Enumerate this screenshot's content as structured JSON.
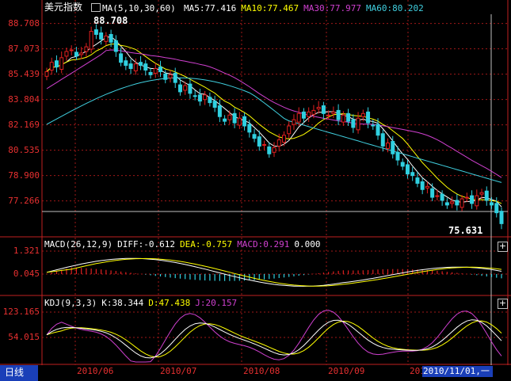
{
  "title": "美元指数",
  "ma_label": "MA(5,10,30,60)",
  "ma_values": [
    {
      "text": "MA5:77.416",
      "color": "#ffffff"
    },
    {
      "text": "MA10:77.467",
      "color": "#ffff00"
    },
    {
      "text": "MA30:77.977",
      "color": "#d040d0"
    },
    {
      "text": "MA60:80.202",
      "color": "#40d0e0"
    }
  ],
  "macd_label": "MACD(26,12,9)",
  "macd_values": [
    {
      "text": "DIFF:-0.612",
      "color": "#ffffff"
    },
    {
      "text": "DEA:-0.757",
      "color": "#ffff00"
    },
    {
      "text": "MACD:0.291",
      "color": "#d040d0"
    },
    {
      "text": "0.000",
      "color": "#ffffff"
    }
  ],
  "kdj_label": "KDJ(9,3,3)",
  "kdj_values": [
    {
      "text": "K:38.344",
      "color": "#ffffff"
    },
    {
      "text": "D:47.438",
      "color": "#ffff00"
    },
    {
      "text": "J:20.157",
      "color": "#d040d0"
    }
  ],
  "price_ticks": [
    "88.708",
    "87.073",
    "85.439",
    "83.804",
    "82.169",
    "80.535",
    "78.900",
    "77.266"
  ],
  "macd_ticks": [
    "1.321",
    "0.045"
  ],
  "kdj_ticks": [
    "123.165",
    "54.015"
  ],
  "max_label": "88.708",
  "min_label": "75.631",
  "period_label": "日线",
  "date_ticks": [
    "2010/06",
    "2010/07",
    "2010/08",
    "2010/09",
    "2010/"
  ],
  "cursor_date": "2010/11/01,一",
  "colors": {
    "up": "#e02020",
    "down": "#30d0e0",
    "grid": "#a01818",
    "axis": "#c02020",
    "ma5": "#ffffff",
    "ma10": "#ffff00",
    "ma30": "#d040d0",
    "ma60": "#40d0e0"
  },
  "chart_data": {
    "type": "candlestick",
    "ylim": [
      75.0,
      89.3
    ],
    "close": [
      85.6,
      86.2,
      85.9,
      86.5,
      86.9,
      87.0,
      86.6,
      86.8,
      87.2,
      88.2,
      88.0,
      87.7,
      87.9,
      87.5,
      86.9,
      86.2,
      86.0,
      85.8,
      86.1,
      86.0,
      85.7,
      85.4,
      85.8,
      85.6,
      85.1,
      85.4,
      84.9,
      84.3,
      84.7,
      84.2,
      84.0,
      83.7,
      84.1,
      83.6,
      83.3,
      82.7,
      82.4,
      82.8,
      82.3,
      82.6,
      82.1,
      81.7,
      81.3,
      80.8,
      80.9,
      80.3,
      80.7,
      81.2,
      81.5,
      82.1,
      82.5,
      82.9,
      82.6,
      83.0,
      83.1,
      83.3,
      82.9,
      82.8,
      83.0,
      82.5,
      82.8,
      82.4,
      82.0,
      82.6,
      82.9,
      82.3,
      82.1,
      81.5,
      80.8,
      81.0,
      80.3,
      79.9,
      79.5,
      79.0,
      78.9,
      78.4,
      78.0,
      78.2,
      77.5,
      77.6,
      77.3,
      77.0,
      77.2,
      77.0,
      77.4,
      77.5,
      77.1,
      77.6,
      77.8,
      77.3,
      77.0,
      76.5,
      75.8
    ]
  }
}
